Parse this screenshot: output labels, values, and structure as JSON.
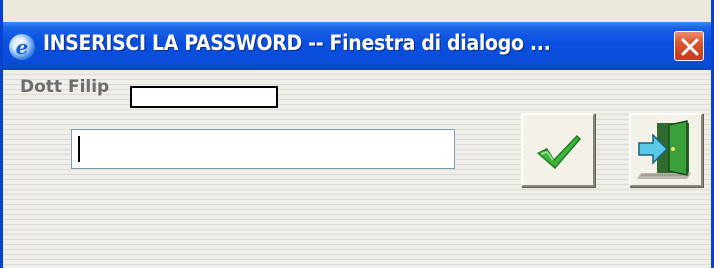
{
  "window": {
    "title": "INSERISCI LA PASSWORD -- Finestra di dialogo ...",
    "app_icon": "internet-explorer-icon",
    "close_icon": "close-icon"
  },
  "form": {
    "user_label": "Dott Filip",
    "password_value": "",
    "ok_icon": "checkmark-icon",
    "exit_icon": "exit-door-icon"
  },
  "colors": {
    "titlebar": "#0a4ede",
    "close_button": "#d9562e",
    "checkmark": "#1e7a1e"
  }
}
